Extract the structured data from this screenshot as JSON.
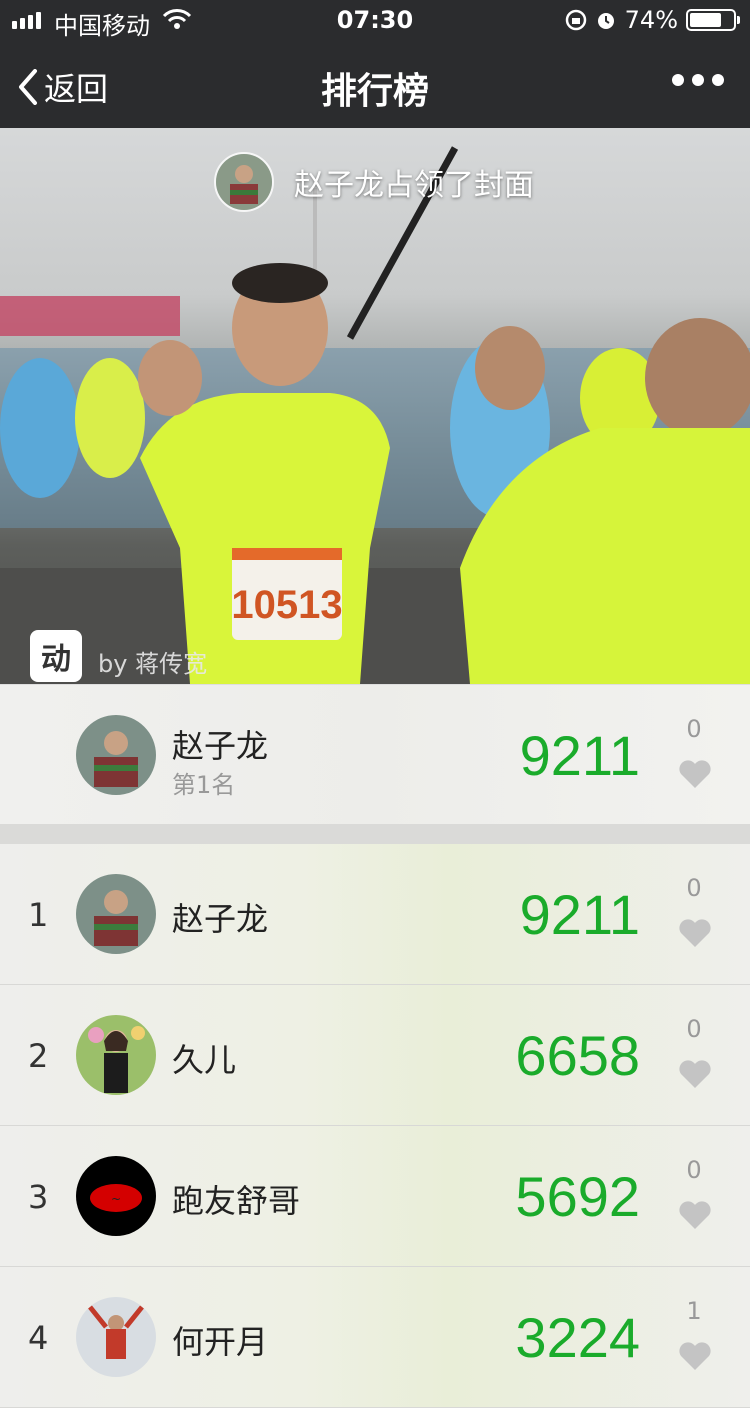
{
  "status_bar": {
    "carrier": "中国移动",
    "time": "07:30",
    "battery": "74%",
    "battery_level": 0.74
  },
  "nav": {
    "back_label": "返回",
    "title": "排行榜"
  },
  "cover": {
    "caption": "赵子龙占领了封面",
    "logo_char": "动",
    "credit": "by 蒋传宽",
    "bib_number": "10513"
  },
  "my_rank": {
    "name": "赵子龙",
    "rank_text": "第1名",
    "steps": "9211",
    "likes": "0"
  },
  "rankings": [
    {
      "index": "1",
      "name": "赵子龙",
      "steps": "9211",
      "likes": "0"
    },
    {
      "index": "2",
      "name": "久儿",
      "steps": "6658",
      "likes": "0"
    },
    {
      "index": "3",
      "name": "跑友舒哥",
      "steps": "5692",
      "likes": "0"
    },
    {
      "index": "4",
      "name": "何开月",
      "steps": "3224",
      "likes": "1"
    }
  ],
  "colors": {
    "accent_green": "#1aab2b",
    "nav_bg": "#2b2c2e",
    "heart_gray": "#c4c4c4"
  }
}
